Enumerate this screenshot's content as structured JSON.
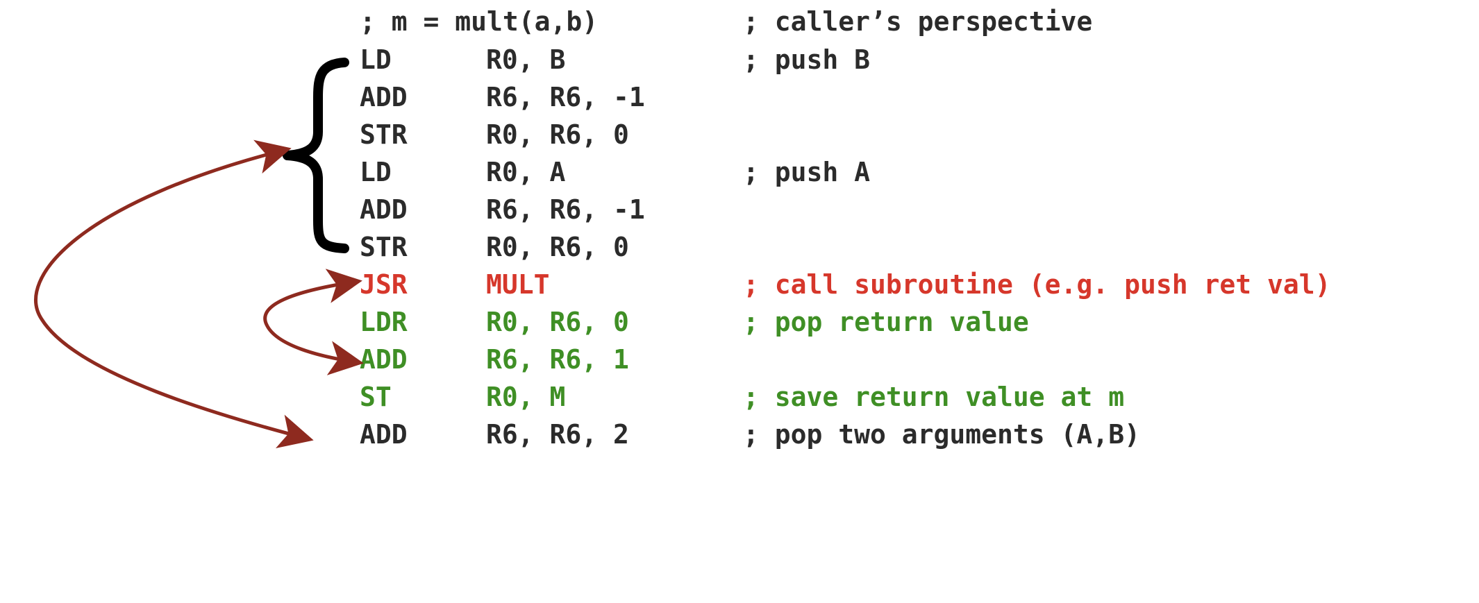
{
  "header": {
    "code": "; m = mult(a,b)",
    "comment": "; caller’s perspective"
  },
  "lines": [
    {
      "op": "LD",
      "args": "R0, B",
      "comment": "; push B",
      "color": "default"
    },
    {
      "op": "ADD",
      "args": "R6, R6, -1",
      "comment": "",
      "color": "default"
    },
    {
      "op": "STR",
      "args": "R0, R6, 0",
      "comment": "",
      "color": "default"
    },
    {
      "op": "LD",
      "args": "R0, A",
      "comment": "; push A",
      "color": "default"
    },
    {
      "op": "ADD",
      "args": "R6, R6, -1",
      "comment": "",
      "color": "default"
    },
    {
      "op": "STR",
      "args": "R0, R6, 0",
      "comment": "",
      "color": "default"
    },
    {
      "op": "JSR",
      "args": "MULT",
      "comment": "; call subroutine (e.g. push ret val)",
      "color": "red"
    },
    {
      "op": "LDR",
      "args": "R0, R6, 0",
      "comment": "; pop return value",
      "color": "green"
    },
    {
      "op": "ADD",
      "args": "R6, R6, 1",
      "comment": "",
      "color": "green"
    },
    {
      "op": "ST",
      "args": "R0, M",
      "comment": "; save return value at m",
      "color": "green"
    },
    {
      "op": "ADD",
      "args": "R6, R6, 2",
      "comment": "; pop two arguments (A,B)",
      "color": "default"
    }
  ],
  "colors": {
    "default": "#2b2b2b",
    "red": "#d6372b",
    "green": "#3f8f25",
    "arrow": "#8e2a1f",
    "brace": "#000000"
  }
}
